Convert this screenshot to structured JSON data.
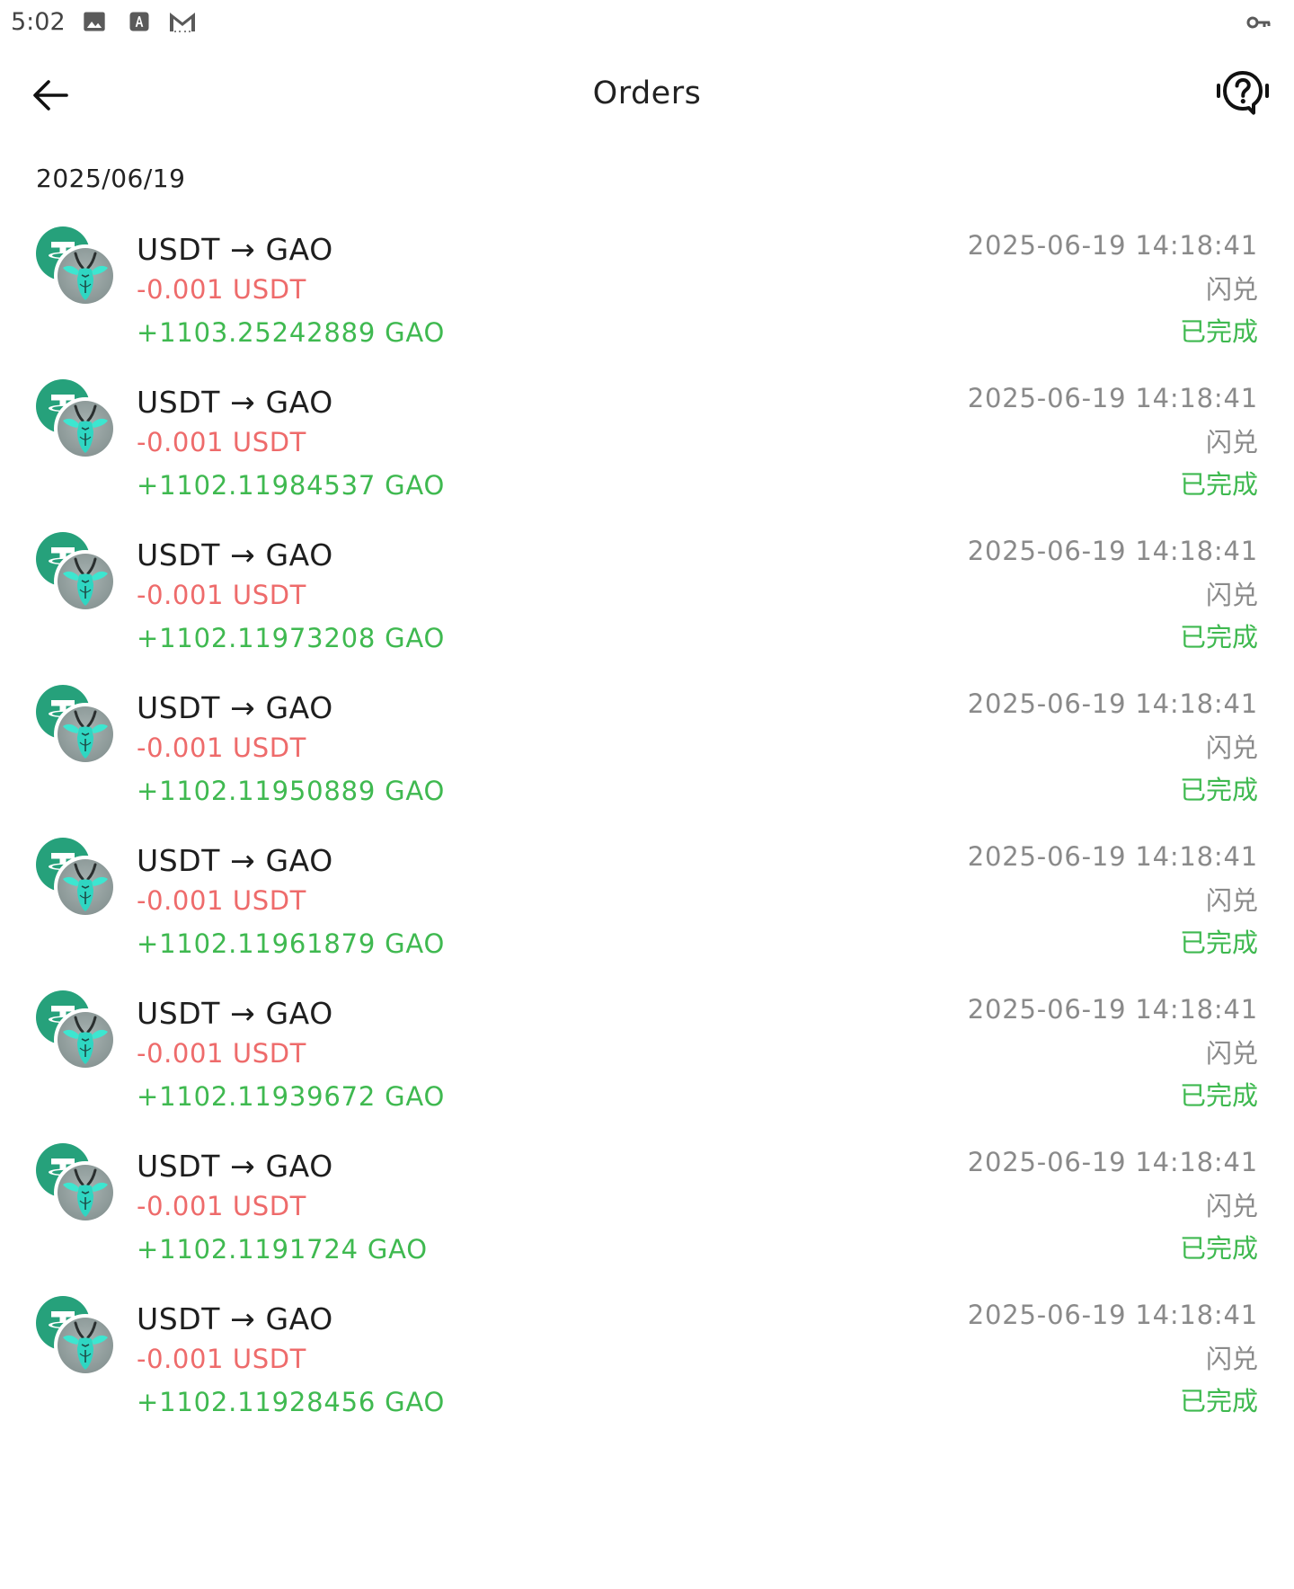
{
  "status_bar": {
    "time": "5:02",
    "icons": [
      "gallery-icon",
      "a-box-icon",
      "gmail-icon",
      "key-icon"
    ]
  },
  "app_bar": {
    "title": "Orders",
    "back_icon": "arrow-left-icon",
    "help_icon": "help-question-icon"
  },
  "date_header": "2025/06/19",
  "colors": {
    "usdt_green": "#26a17b",
    "sent_red": "#ee6b6b",
    "received_green": "#3fb950",
    "muted_gray": "#8a8a8a"
  },
  "orders": [
    {
      "pair": "USDT → GAO",
      "sent": "-0.001 USDT",
      "received": "+1103.25242889 GAO",
      "time": "2025-06-19 14:18:41",
      "type": "闪兑",
      "status": "已完成"
    },
    {
      "pair": "USDT → GAO",
      "sent": "-0.001 USDT",
      "received": "+1102.11984537 GAO",
      "time": "2025-06-19 14:18:41",
      "type": "闪兑",
      "status": "已完成"
    },
    {
      "pair": "USDT → GAO",
      "sent": "-0.001 USDT",
      "received": "+1102.11973208 GAO",
      "time": "2025-06-19 14:18:41",
      "type": "闪兑",
      "status": "已完成"
    },
    {
      "pair": "USDT → GAO",
      "sent": "-0.001 USDT",
      "received": "+1102.11950889 GAO",
      "time": "2025-06-19 14:18:41",
      "type": "闪兑",
      "status": "已完成"
    },
    {
      "pair": "USDT → GAO",
      "sent": "-0.001 USDT",
      "received": "+1102.11961879 GAO",
      "time": "2025-06-19 14:18:41",
      "type": "闪兑",
      "status": "已完成"
    },
    {
      "pair": "USDT → GAO",
      "sent": "-0.001 USDT",
      "received": "+1102.11939672 GAO",
      "time": "2025-06-19 14:18:41",
      "type": "闪兑",
      "status": "已完成"
    },
    {
      "pair": "USDT → GAO",
      "sent": "-0.001 USDT",
      "received": "+1102.1191724 GAO",
      "time": "2025-06-19 14:18:41",
      "type": "闪兑",
      "status": "已完成"
    },
    {
      "pair": "USDT → GAO",
      "sent": "-0.001 USDT",
      "received": "+1102.11928456 GAO",
      "time": "2025-06-19 14:18:41",
      "type": "闪兑",
      "status": "已完成"
    }
  ]
}
